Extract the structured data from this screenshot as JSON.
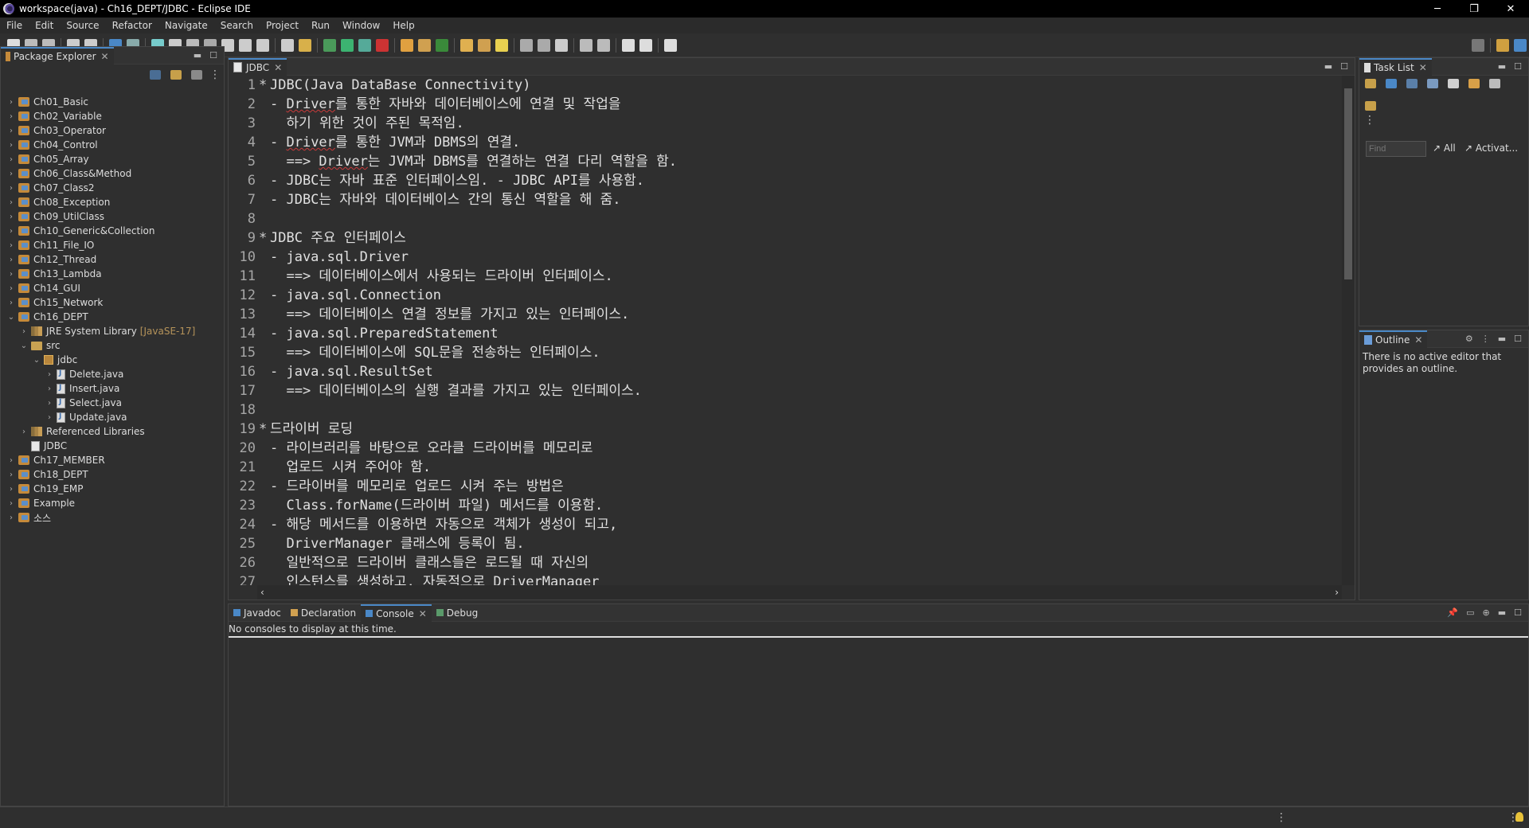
{
  "window": {
    "title": "workspace(java) - Ch16_DEPT/JDBC - Eclipse IDE",
    "minimize": "─",
    "restore": "❐",
    "close": "✕"
  },
  "menu": [
    "File",
    "Edit",
    "Source",
    "Refactor",
    "Navigate",
    "Search",
    "Project",
    "Run",
    "Window",
    "Help"
  ],
  "package_explorer": {
    "tab_label": "Package Explorer",
    "items": [
      {
        "label": "Ch01_Basic",
        "type": "project",
        "depth": 0,
        "arrow": "›"
      },
      {
        "label": "Ch02_Variable",
        "type": "project",
        "depth": 0,
        "arrow": "›"
      },
      {
        "label": "Ch03_Operator",
        "type": "project",
        "depth": 0,
        "arrow": "›"
      },
      {
        "label": "Ch04_Control",
        "type": "project",
        "depth": 0,
        "arrow": "›"
      },
      {
        "label": "Ch05_Array",
        "type": "project",
        "depth": 0,
        "arrow": "›"
      },
      {
        "label": "Ch06_Class&Method",
        "type": "project",
        "depth": 0,
        "arrow": "›"
      },
      {
        "label": "Ch07_Class2",
        "type": "project",
        "depth": 0,
        "arrow": "›"
      },
      {
        "label": "Ch08_Exception",
        "type": "project",
        "depth": 0,
        "arrow": "›"
      },
      {
        "label": "Ch09_UtilClass",
        "type": "project",
        "depth": 0,
        "arrow": "›"
      },
      {
        "label": "Ch10_Generic&Collection",
        "type": "project",
        "depth": 0,
        "arrow": "›"
      },
      {
        "label": "Ch11_File_IO",
        "type": "project",
        "depth": 0,
        "arrow": "›"
      },
      {
        "label": "Ch12_Thread",
        "type": "project",
        "depth": 0,
        "arrow": "›"
      },
      {
        "label": "Ch13_Lambda",
        "type": "project",
        "depth": 0,
        "arrow": "›"
      },
      {
        "label": "Ch14_GUI",
        "type": "project",
        "depth": 0,
        "arrow": "›"
      },
      {
        "label": "Ch15_Network",
        "type": "project",
        "depth": 0,
        "arrow": "›"
      },
      {
        "label": "Ch16_DEPT",
        "type": "project",
        "depth": 0,
        "arrow": "⌄"
      },
      {
        "label": "JRE System Library",
        "extra": "[JavaSE-17]",
        "type": "library",
        "depth": 1,
        "arrow": "›"
      },
      {
        "label": "src",
        "type": "folder",
        "depth": 1,
        "arrow": "⌄"
      },
      {
        "label": "jdbc",
        "type": "package",
        "depth": 2,
        "arrow": "⌄"
      },
      {
        "label": "Delete.java",
        "type": "java",
        "depth": 3,
        "arrow": "›"
      },
      {
        "label": "Insert.java",
        "type": "java",
        "depth": 3,
        "arrow": "›"
      },
      {
        "label": "Select.java",
        "type": "java",
        "depth": 3,
        "arrow": "›"
      },
      {
        "label": "Update.java",
        "type": "java",
        "depth": 3,
        "arrow": "›"
      },
      {
        "label": "Referenced Libraries",
        "type": "library",
        "depth": 1,
        "arrow": "›"
      },
      {
        "label": "JDBC",
        "type": "file",
        "depth": 1,
        "arrow": ""
      },
      {
        "label": "Ch17_MEMBER",
        "type": "project",
        "depth": 0,
        "arrow": "›"
      },
      {
        "label": "Ch18_DEPT",
        "type": "project",
        "depth": 0,
        "arrow": "›"
      },
      {
        "label": "Ch19_EMP",
        "type": "project",
        "depth": 0,
        "arrow": "›"
      },
      {
        "label": "Example",
        "type": "project",
        "depth": 0,
        "arrow": "›"
      },
      {
        "label": "소스",
        "type": "project",
        "depth": 0,
        "arrow": "›"
      }
    ]
  },
  "editor": {
    "tab_label": "JDBC",
    "lines": [
      {
        "n": "1",
        "fold": "*",
        "text": "JDBC(Java DataBase Connectivity)"
      },
      {
        "n": "2",
        "fold": "",
        "pre": "- ",
        "sq": "Driver",
        "text": "를 통한 자바와 데이터베이스에 연결 및 작업을"
      },
      {
        "n": "3",
        "fold": "",
        "text": "  하기 위한 것이 주된 목적임."
      },
      {
        "n": "4",
        "fold": "",
        "pre": "- ",
        "sq": "Driver",
        "text": "를 통한 JVM과 DBMS의 연결."
      },
      {
        "n": "5",
        "fold": "",
        "pre": "  ==> ",
        "sq": "Driver",
        "text": "는 JVM과 DBMS를 연결하는 연결 다리 역할을 함."
      },
      {
        "n": "6",
        "fold": "",
        "text": "- JDBC는 자바 표준 인터페이스임. - JDBC API를 사용함."
      },
      {
        "n": "7",
        "fold": "",
        "text": "- JDBC는 자바와 데이터베이스 간의 통신 역할을 해 줌."
      },
      {
        "n": "8",
        "fold": "",
        "text": ""
      },
      {
        "n": "9",
        "fold": "*",
        "text": "JDBC 주요 인터페이스"
      },
      {
        "n": "10",
        "fold": "",
        "text": "- java.sql.Driver"
      },
      {
        "n": "11",
        "fold": "",
        "text": "  ==> 데이터베이스에서 사용되는 드라이버 인터페이스."
      },
      {
        "n": "12",
        "fold": "",
        "text": "- java.sql.Connection"
      },
      {
        "n": "13",
        "fold": "",
        "text": "  ==> 데이터베이스 연결 정보를 가지고 있는 인터페이스."
      },
      {
        "n": "14",
        "fold": "",
        "text": "- java.sql.PreparedStatement"
      },
      {
        "n": "15",
        "fold": "",
        "text": "  ==> 데이터베이스에 SQL문을 전송하는 인터페이스."
      },
      {
        "n": "16",
        "fold": "",
        "text": "- java.sql.ResultSet"
      },
      {
        "n": "17",
        "fold": "",
        "text": "  ==> 데이터베이스의 실행 결과를 가지고 있는 인터페이스."
      },
      {
        "n": "18",
        "fold": "",
        "text": ""
      },
      {
        "n": "19",
        "fold": "*",
        "text": "드라이버 로딩"
      },
      {
        "n": "20",
        "fold": "",
        "text": "- 라이브러리를 바탕으로 오라클 드라이버를 메모리로"
      },
      {
        "n": "21",
        "fold": "",
        "text": "  업로드 시켜 주어야 함."
      },
      {
        "n": "22",
        "fold": "",
        "text": "- 드라이버를 메모리로 업로드 시켜 주는 방법은"
      },
      {
        "n": "23",
        "fold": "",
        "text": "  Class.forName(드라이버 파일) 메서드를 이용함."
      },
      {
        "n": "24",
        "fold": "",
        "text": "- 해당 메서드를 이용하면 자동으로 객체가 생성이 되고,"
      },
      {
        "n": "25",
        "fold": "",
        "text": "  DriverManager 클래스에 등록이 됨."
      },
      {
        "n": "26",
        "fold": "",
        "text": "  일반적으로 드라이버 클래스들은 로드될 때 자신의"
      },
      {
        "n": "27",
        "fold": "",
        "text": "  인스턴스를 생성하고, 자동적으로 DriverManager"
      }
    ],
    "scroll_left": "‹",
    "scroll_right": "›"
  },
  "task_list": {
    "tab_label": "Task List",
    "find_placeholder": "Find",
    "all_label": "All",
    "activate_label": "Activat..."
  },
  "outline": {
    "tab_label": "Outline",
    "message": "There is no active editor that provides an outline."
  },
  "bottom": {
    "tabs": [
      "Javadoc",
      "Declaration",
      "Console",
      "Debug"
    ],
    "active_tab": "Console",
    "message": "No consoles to display at this time."
  },
  "colors": {
    "accent": "#4a88c7",
    "squiggle": "#c93a3a"
  }
}
